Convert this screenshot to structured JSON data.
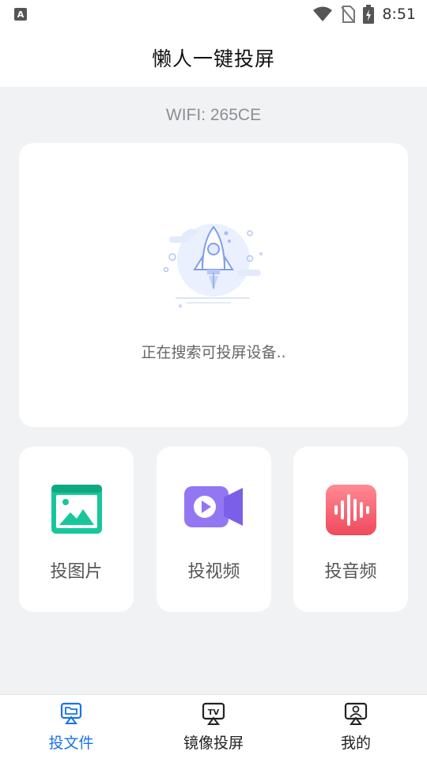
{
  "status_bar": {
    "notification_badge": "A",
    "time": "8:51",
    "icons": [
      "wifi-icon",
      "no-sim-icon",
      "battery-charging-icon"
    ]
  },
  "header": {
    "title": "懒人一键投屏"
  },
  "wifi": {
    "label": "WIFI: 265CE"
  },
  "search": {
    "status_text": "正在搜索可投屏设备.."
  },
  "actions": [
    {
      "label": "投图片",
      "icon": "image-icon",
      "color": "#1dcfa1"
    },
    {
      "label": "投视频",
      "icon": "video-camera-icon",
      "color": "#8b6cf0"
    },
    {
      "label": "投音频",
      "icon": "audio-wave-icon",
      "color": "#f45b6c"
    }
  ],
  "nav": {
    "items": [
      {
        "label": "投文件",
        "icon": "cast-file-icon",
        "active": true
      },
      {
        "label": "镜像投屏",
        "icon": "tv-mirror-icon",
        "active": false
      },
      {
        "label": "我的",
        "icon": "profile-icon",
        "active": false
      }
    ],
    "active_color": "#1a73e8"
  }
}
